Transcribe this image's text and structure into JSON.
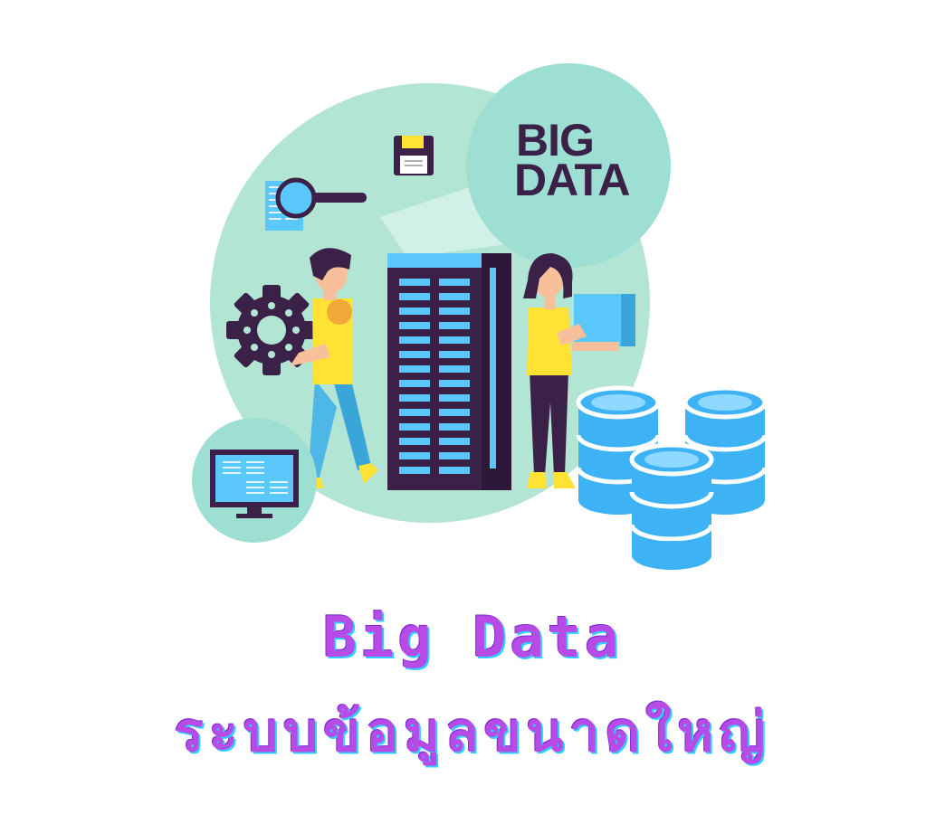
{
  "illustration": {
    "badge_line1": "BIG",
    "badge_line2": "DATA"
  },
  "caption": {
    "title": "Big Data",
    "subtitle": "ระบบข้อมูลขนาดใหญ่"
  },
  "colors": {
    "mint": "#b2e5d3",
    "badge_mint": "#9ddfd3",
    "dark_purple": "#3b2148",
    "server_blue": "#5ac8fa",
    "db_blue": "#3db3f5",
    "yellow": "#ffe234",
    "caption_purple": "#b84ae6",
    "caption_cyan": "#2fd0ff"
  }
}
